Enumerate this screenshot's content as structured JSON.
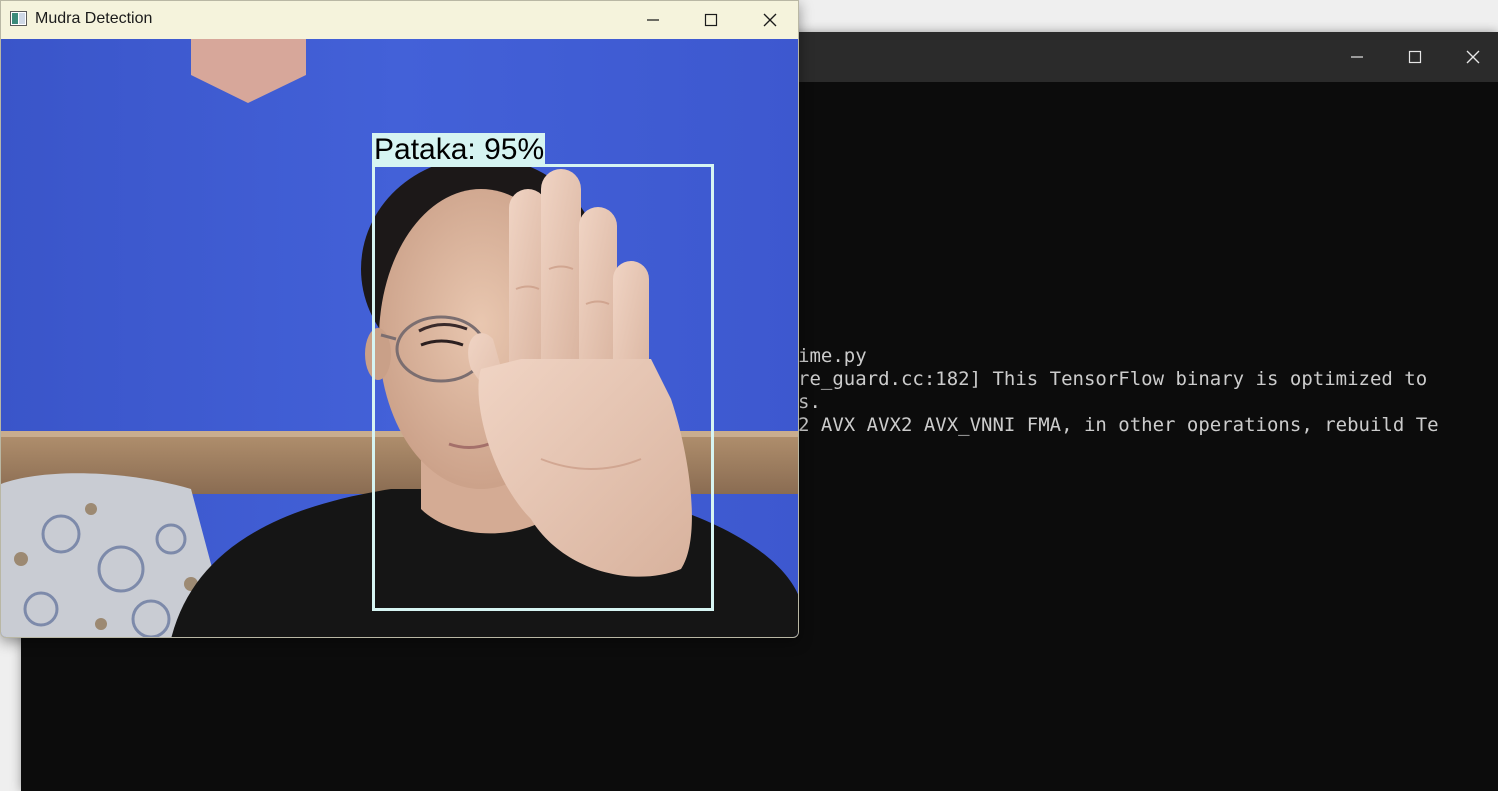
{
  "mudra_window": {
    "title": "Mudra Detection",
    "app_icon": "window-app-icon",
    "controls": {
      "minimize_icon": "minimize-icon",
      "maximize_icon": "maximize-icon",
      "close_icon": "close-icon"
    },
    "detection": {
      "label": "Pataka: 95%",
      "box_color": "#d6f4f2"
    }
  },
  "terminal_window": {
    "controls": {
      "minimize_icon": "minimize-icon",
      "maximize_icon": "maximize-icon",
      "close_icon": "close-icon"
    },
    "lines": [
      "ime.py",
      "re_guard.cc:182] This TensorFlow binary is optimized to",
      "s.",
      "2 AVX AVX2 AVX_VNNI FMA, in other operations, rebuild Te"
    ]
  },
  "colors": {
    "terminal_bg": "#0c0c0c",
    "terminal_titlebar": "#2b2b2b",
    "mudra_titlebar": "#f5f3dc",
    "wall_blue": "#3f5bd6"
  }
}
